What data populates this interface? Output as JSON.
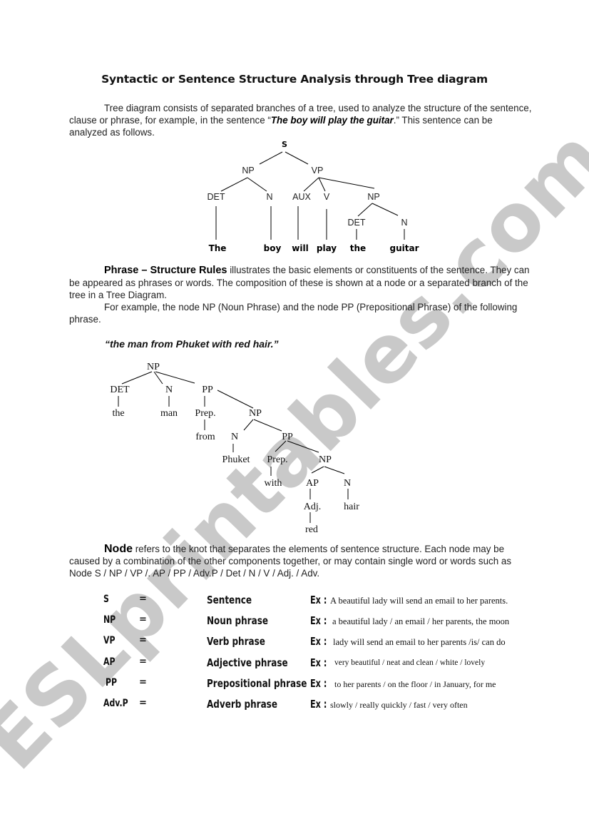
{
  "watermark": "ESLprintables.com",
  "title": "Syntactic or Sentence Structure Analysis through Tree diagram",
  "intro": {
    "text_before": "Tree diagram consists of separated branches of a tree, used to analyze the structure of the sentence, clause or phrase, for example, in the sentence “",
    "example_sentence": "The boy will play the guitar",
    "text_after": ".” This sentence can be analyzed as follows."
  },
  "tree1": {
    "root": "S",
    "nodes": {
      "np": "NP",
      "vp": "VP",
      "det1": "DET",
      "n1": "N",
      "aux": "AUX",
      "v": "V",
      "np2": "NP",
      "det2": "DET",
      "n2": "N"
    },
    "words": [
      "The",
      "boy",
      "will",
      "play",
      "the",
      "guitar"
    ]
  },
  "phrase_rules": {
    "heading": "Phrase – Structure Rules",
    "text1": " illustrates the basic elements or constituents of the sentence. They can be appeared as phrases or words. The composition of these is shown at a node or a separated branch of the tree in a Tree Diagram.",
    "text2": "For example, the node NP (Noun Phrase) and the node PP (Prepositional Phrase) of the following phrase."
  },
  "example_phrase": "“the man from Phuket with red hair.”",
  "tree2": {
    "np_root": "NP",
    "det": "DET",
    "the": "the",
    "n_man": "N",
    "man": "man",
    "pp1": "PP",
    "prep1": "Prep.",
    "from": "from",
    "np2": "NP",
    "n_phuket": "N",
    "phuket": "Phuket",
    "pp2": "PP",
    "prep2": "Prep.",
    "with": "with",
    "np3": "NP",
    "ap": "AP",
    "adj": "Adj.",
    "red": "red",
    "n_hair": "N",
    "hair": "hair"
  },
  "node_section": {
    "heading": "Node",
    "text": " refers to the knot that separates the elements of sentence structure. Each node may be caused by a combination of the other components together, or may contain single word or words such as Node S / NP / VP /. AP / PP / Adv.P / Det / N / V / Adj. / Adv."
  },
  "abbreviations": [
    {
      "abbr": "S",
      "eq": "=",
      "full": "Sentence",
      "ex_label": "Ex :",
      "example": "A beautiful lady will send an email to her parents."
    },
    {
      "abbr": "NP",
      "eq": "=",
      "full": "Noun phrase",
      "ex_label": "Ex :",
      "example": "a beautiful lady / an email / her parents, the moon"
    },
    {
      "abbr": "VP",
      "eq": "=",
      "full": "Verb phrase",
      "ex_label": "Ex :",
      "example": "lady will send an email to her parents /is/ can do"
    },
    {
      "abbr": "AP",
      "eq": "=",
      "full": "Adjective phrase",
      "ex_label": "Ex :",
      "example": "very beautiful / neat and clean / white / lovely"
    },
    {
      "abbr": "PP",
      "eq": "=",
      "full": "Prepositional phrase",
      "ex_label": "Ex :",
      "example": "to her parents / on the floor / in January, for me"
    },
    {
      "abbr": "Adv.P",
      "eq": "=",
      "full": "Adverb phrase",
      "ex_label": "Ex :",
      "example": "slowly / really quickly / fast / very often"
    }
  ]
}
